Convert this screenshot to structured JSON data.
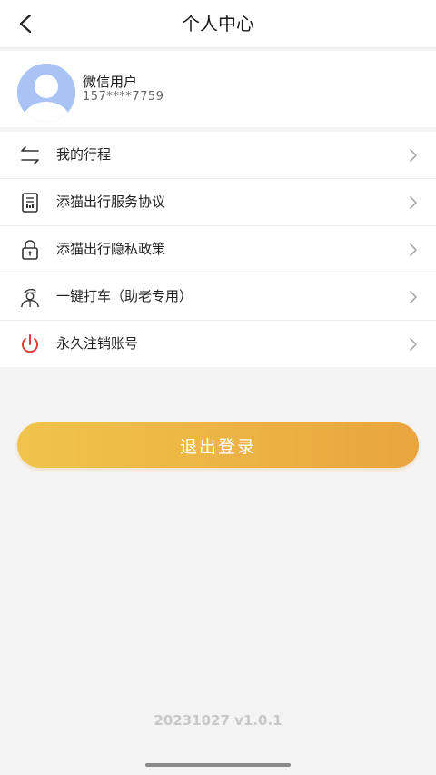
{
  "header": {
    "title": "个人中心",
    "back_icon": "chevron-left-icon"
  },
  "profile": {
    "name": "微信用户",
    "phone": "157****7759",
    "avatar_color": "#a9c3f5"
  },
  "menu": {
    "items": [
      {
        "label": "我的行程",
        "icon": "route-arrows-icon"
      },
      {
        "label": "添猫出行服务协议",
        "icon": "document-icon"
      },
      {
        "label": "添猫出行隐私政策",
        "icon": "lock-icon"
      },
      {
        "label": "一键打车（助老专用）",
        "icon": "driver-icon"
      },
      {
        "label": "永久注销账号",
        "icon": "power-icon",
        "icon_color": "#e53935"
      }
    ]
  },
  "logout": {
    "label": "退出登录",
    "gradient_start": "#f0c44c",
    "gradient_end": "#e9a53d"
  },
  "footer": {
    "version": "20231027 v1.0.1"
  }
}
